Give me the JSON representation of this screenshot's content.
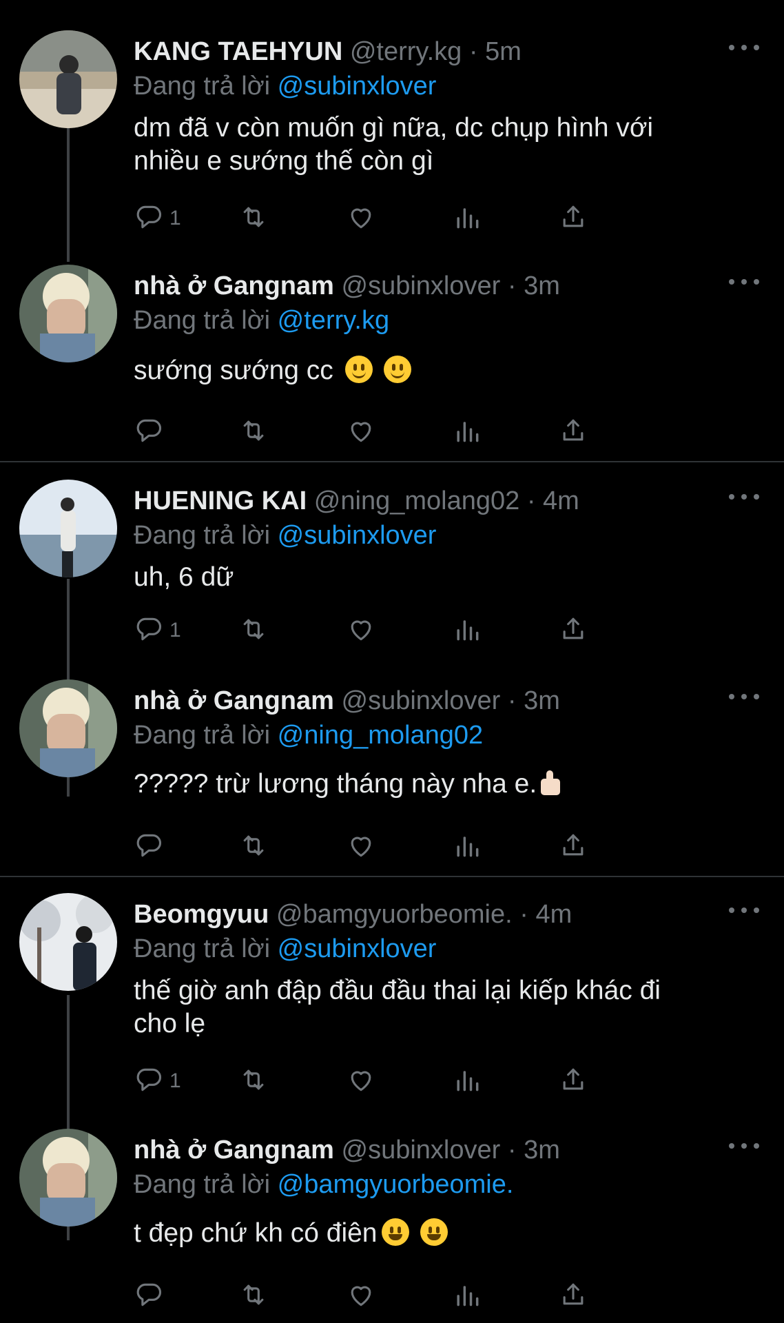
{
  "replying_prefix": "Đang trả lời",
  "colors": {
    "background": "#000000",
    "mention": "#1d9bf0",
    "muted": "#71767b",
    "text": "#e7e9ea",
    "divider": "#2f3336"
  },
  "icons": [
    "reply-icon",
    "retweet-icon",
    "like-icon",
    "views-icon",
    "share-icon",
    "more-icon"
  ],
  "threads": [
    {
      "tweets": [
        {
          "name": "KANG TAEHYUN",
          "handle": "@terry.kg",
          "dot": "·",
          "time": "5m",
          "replying_to": "@subinxlover",
          "text_lines": [
            "dm đã v còn muốn gì nữa, dc chụp hình với",
            "nhiều e sướng thế còn gì"
          ],
          "reply_count": "1"
        },
        {
          "name": "nhà ở Gangnam",
          "handle": "@subinxlover",
          "dot": "·",
          "time": "3m",
          "replying_to": "@terry.kg",
          "text_lines": [
            "sướng sướng cc"
          ],
          "emojis": [
            "slightly-smiling-face",
            "slightly-smiling-face"
          ],
          "reply_count": ""
        }
      ]
    },
    {
      "tweets": [
        {
          "name": "HUENING KAI",
          "handle": "@ning_molang02",
          "dot": "·",
          "time": "4m",
          "replying_to": "@subinxlover",
          "text_lines": [
            "uh, 6 dữ"
          ],
          "reply_count": "1"
        },
        {
          "name": "nhà ở Gangnam",
          "handle": "@subinxlover",
          "dot": "·",
          "time": "3m",
          "replying_to": "@ning_molang02",
          "text_lines": [
            "????? trừ lương tháng này nha e."
          ],
          "emojis": [
            "thumbs-up"
          ],
          "reply_count": ""
        }
      ]
    },
    {
      "tweets": [
        {
          "name": "Beomgyuu",
          "handle": "@bamgyuorbeomie.",
          "dot": "·",
          "time": "4m",
          "replying_to": "@subinxlover",
          "text_lines": [
            "thế giờ anh đập đầu đầu thai lại kiếp khác đi",
            "cho lẹ"
          ],
          "reply_count": "1"
        },
        {
          "name": "nhà ở Gangnam",
          "handle": "@subinxlover",
          "dot": "·",
          "time": "3m",
          "replying_to": "@bamgyuorbeomie.",
          "text_lines": [
            "t đẹp chứ kh có điên"
          ],
          "emojis": [
            "grinning-face",
            "grinning-face"
          ],
          "reply_count": ""
        }
      ]
    }
  ]
}
